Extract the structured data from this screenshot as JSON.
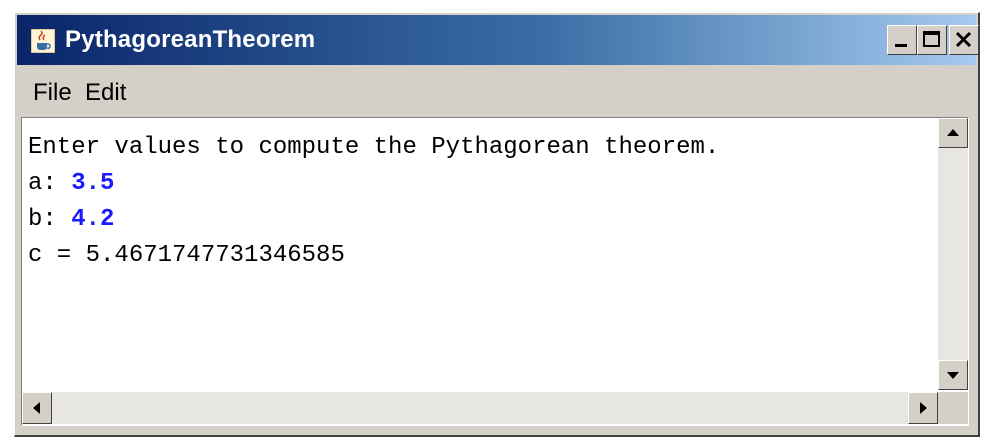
{
  "window": {
    "title": "PythagoreanTheorem",
    "icons": {
      "app": "java-cup-icon",
      "minimize": "minimize-icon",
      "maximize": "maximize-icon",
      "close": "close-icon"
    }
  },
  "menu": {
    "items": [
      {
        "label": "File"
      },
      {
        "label": "Edit"
      }
    ]
  },
  "console": {
    "prompt": "Enter values to compute the Pythagorean theorem.",
    "a_label": "a: ",
    "a_value": "3.5",
    "b_label": "b: ",
    "b_value": "4.2",
    "result": "c = 5.4671747731346585"
  },
  "colors": {
    "input_text": "#1a1aff",
    "title_gradient_start": "#0a246a",
    "title_gradient_end": "#a6caf0"
  }
}
